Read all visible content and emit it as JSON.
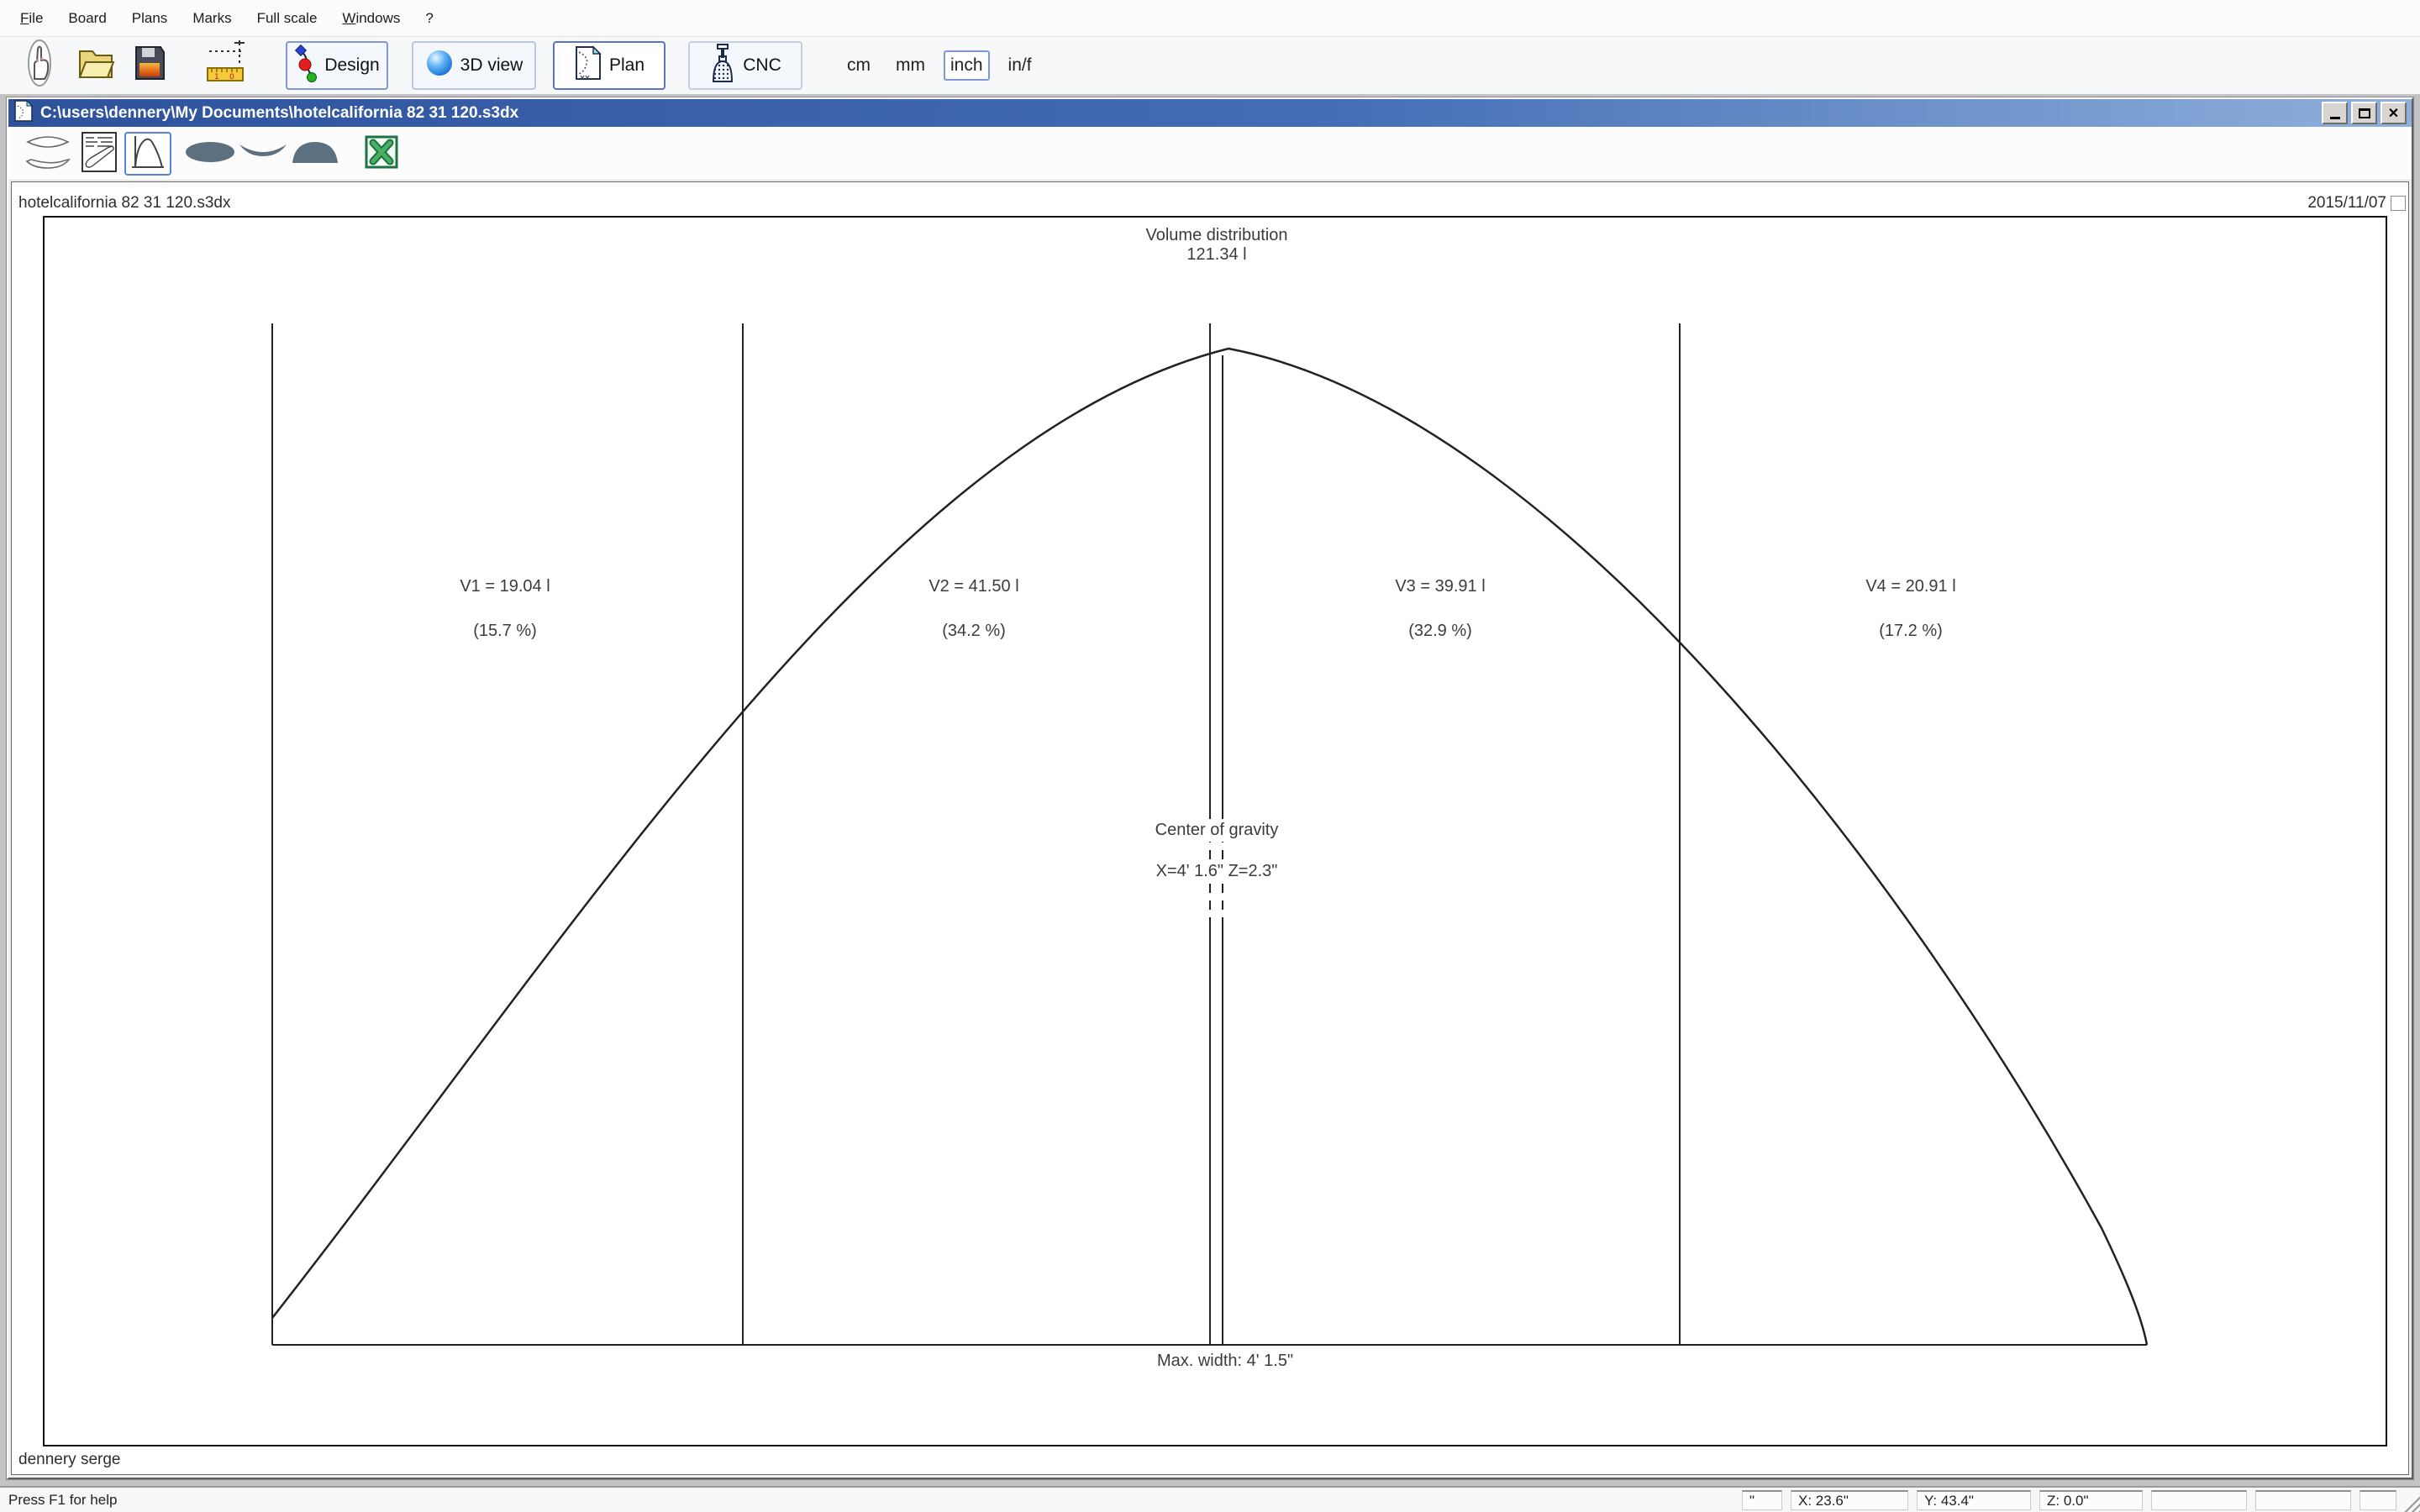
{
  "menu": {
    "items": [
      "File",
      "Board",
      "Plans",
      "Marks",
      "Full scale",
      "Windows",
      "?"
    ]
  },
  "toolbar": {
    "buttons": {
      "design": "Design",
      "view3d": "3D view",
      "plan": "Plan",
      "cnc": "CNC"
    },
    "units": [
      "cm",
      "mm",
      "inch",
      "in/f"
    ],
    "active_unit": "inch"
  },
  "child_window": {
    "title": "C:\\users\\dennery\\My Documents\\hotelcalifornia 82 31 120.s3dx"
  },
  "document": {
    "name": "hotelcalifornia 82 31 120.s3dx",
    "date": "2015/11/07",
    "author": "dennery serge"
  },
  "chart_data": {
    "type": "area",
    "title": "Volume distribution",
    "total_volume_label": "121.34 l",
    "total_volume_liters": 121.34,
    "unit": "liters",
    "sections": [
      {
        "name": "V1",
        "volume_liters": 19.04,
        "percent": 15.7,
        "label": "V1 = 19.04 l",
        "percent_label": "(15.7 %)"
      },
      {
        "name": "V2",
        "volume_liters": 41.5,
        "percent": 34.2,
        "label": "V2 = 41.50 l",
        "percent_label": "(34.2 %)"
      },
      {
        "name": "V3",
        "volume_liters": 39.91,
        "percent": 32.9,
        "label": "V3 = 39.91 l",
        "percent_label": "(32.9 %)"
      },
      {
        "name": "V4",
        "volume_liters": 20.91,
        "percent": 17.2,
        "label": "V4 = 20.91 l",
        "percent_label": "(17.2 %)"
      }
    ],
    "center_of_gravity": {
      "title": "Center of gravity",
      "value": "X=4' 1.6\" Z=2.3\""
    },
    "max_width_label": "Max. width: 4' 1.5\"",
    "legend": false,
    "grid": false
  },
  "statusbar": {
    "help": "Press F1 for help",
    "unit_indicator": "\"",
    "x": "X: 23.6\"",
    "y": "Y: 43.4\"",
    "z": "Z: 0.0\""
  }
}
